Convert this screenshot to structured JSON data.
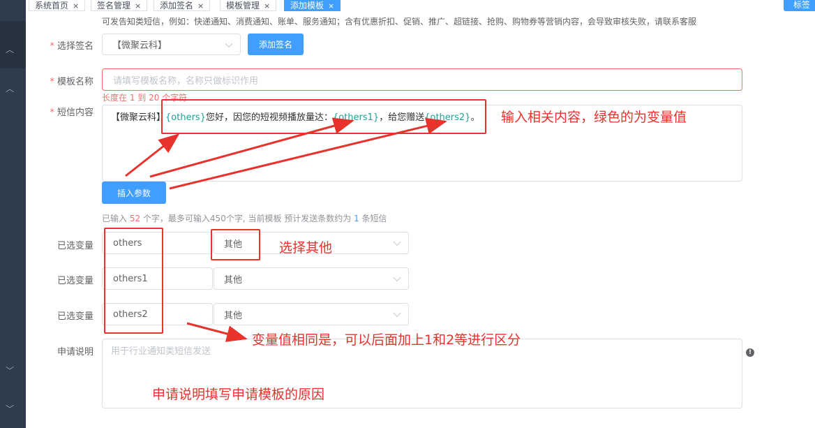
{
  "tabs": [
    {
      "label": "系统首页",
      "close": "×"
    },
    {
      "label": "签名管理",
      "close": "×"
    },
    {
      "label": "添加签名",
      "close": "×"
    },
    {
      "label": "模板管理",
      "close": "×"
    },
    {
      "label": "添加模板",
      "close": "×"
    }
  ],
  "tag_button": "标签",
  "hint": "可发告知类短信，例如：快递通知、消费通知、账单、服务通知；含有优惠折扣、促销、推广、超链接、抢购、购物券等营销内容，会导致审核失败，请联系客服",
  "signature": {
    "label": "选择签名",
    "value": "【微聚云科】",
    "add_button": "添加签名"
  },
  "template_name": {
    "label": "模板名称",
    "placeholder": "请填写模板名称，名称只做标识作用",
    "error": "长度在 1 到 20 个字符"
  },
  "sms_content": {
    "label": "短信内容",
    "parts": {
      "p1": "【微聚云科】",
      "v1": "{others}",
      "p2": "您好，因您的短视频播放量达：",
      "v2": "{others1}",
      "p3": "，给您赠送",
      "v3": "{others2}",
      "p4": "。"
    },
    "insert_button": "插入参数"
  },
  "count": {
    "prefix": "已输入 ",
    "typed": "52",
    "middle": " 个字，最多可输入450个字, 当前模板 预计发送条数约为 ",
    "msgs": "1",
    "suffix": " 条短信"
  },
  "variables": [
    {
      "label": "已选变量",
      "name": "others",
      "type": "其他"
    },
    {
      "label": "已选变量",
      "name": "others1",
      "type": "其他"
    },
    {
      "label": "已选变量",
      "name": "others2",
      "type": "其他"
    }
  ],
  "description": {
    "label": "申请说明",
    "placeholder": "用于行业通知类短信发送"
  },
  "annotations": {
    "content": "输入相关内容，绿色的为变量值",
    "choose_other": "选择其他",
    "same_vars": "变量值相同是，可以后面加上1和2等进行区分",
    "desc": "申请说明填写申请模板的原因"
  },
  "colors": {
    "primary": "#409eff",
    "annotation": "#e8322c",
    "variable": "#19a397",
    "sidebar": "#2f3c4e"
  }
}
